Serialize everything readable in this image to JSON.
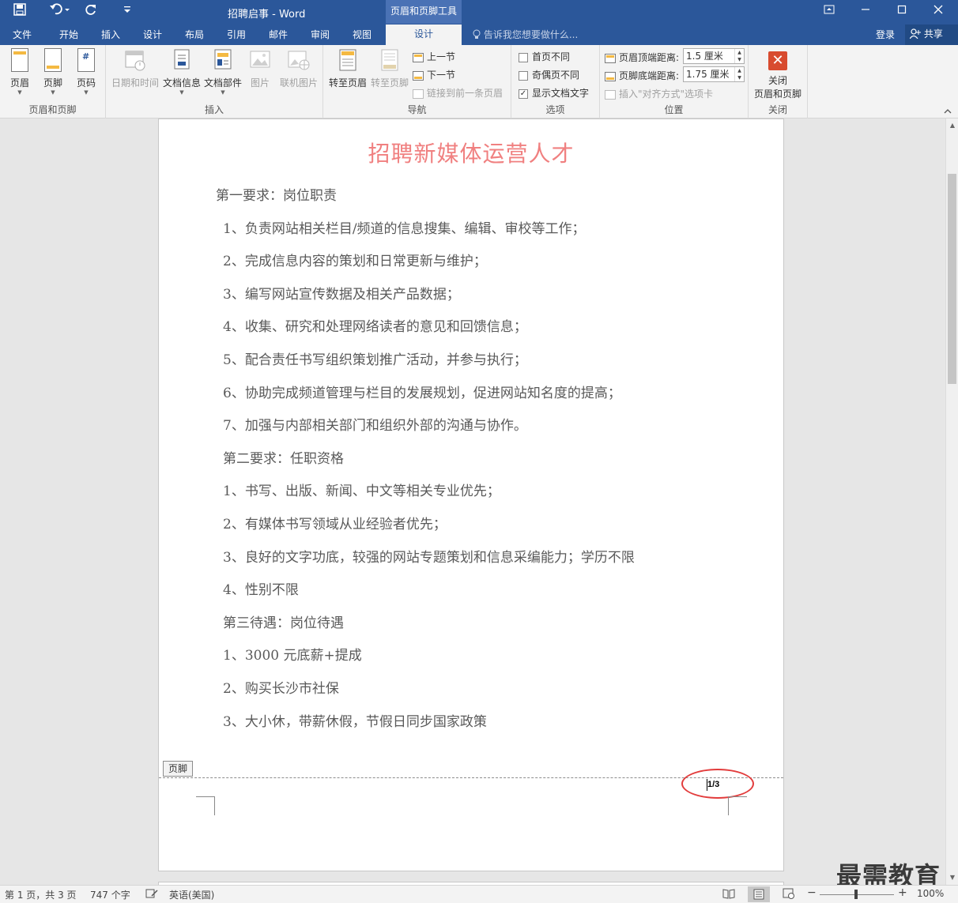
{
  "titlebar": {
    "doc_title": "招聘启事 - Word",
    "context_tool": "页眉和页脚工具",
    "save_icon": "save-icon",
    "undo_icon": "undo-icon",
    "redo_icon": "redo-icon",
    "customize_icon": "customize-qat-icon"
  },
  "tabs": [
    "文件",
    "开始",
    "插入",
    "设计",
    "布局",
    "引用",
    "邮件",
    "审阅",
    "视图",
    "设计"
  ],
  "active_tab": "设计",
  "tellme_placeholder": "告诉我您想要做什么...",
  "login": "登录",
  "share": "共享",
  "ribbon": {
    "groups": {
      "hf": "页眉和页脚",
      "insert": "插入",
      "nav": "导航",
      "options": "选项",
      "position": "位置",
      "close": "关闭"
    },
    "hf_buttons": [
      "页眉",
      "页脚",
      "页码"
    ],
    "insert_buttons": [
      "日期和时间",
      "文档信息",
      "文档部件",
      "图片",
      "联机图片"
    ],
    "nav_big": [
      "转至页眉",
      "转至页脚"
    ],
    "nav_small": [
      "上一节",
      "下一节",
      "链接到前一条页眉"
    ],
    "options": [
      {
        "label": "首页不同",
        "checked": false
      },
      {
        "label": "奇偶页不同",
        "checked": false
      },
      {
        "label": "显示文档文字",
        "checked": true
      }
    ],
    "position": {
      "header_label": "页眉顶端距离:",
      "header_value": "1.5 厘米",
      "footer_label": "页脚底端距离:",
      "footer_value": "1.75 厘米",
      "align_tab": "插入\"对齐方式\"选项卡"
    },
    "close_label_1": "关闭",
    "close_label_2": "页眉和页脚"
  },
  "document": {
    "title": "招聘新媒体运营人才",
    "lines": [
      "第一要求：岗位职责",
      "1、负责网站相关栏目/频道的信息搜集、编辑、审校等工作；",
      "2、完成信息内容的策划和日常更新与维护；",
      "3、编写网站宣传数据及相关产品数据；",
      "4、收集、研究和处理网络读者的意见和回馈信息；",
      "5、配合责任书写组织策划推广活动，并参与执行；",
      "6、协助完成频道管理与栏目的发展规划，促进网站知名度的提高；",
      "7、加强与内部相关部门和组织外部的沟通与协作。",
      "第二要求：任职资格",
      "1、书写、出版、新闻、中文等相关专业优先；",
      "2、有媒体书写领域从业经验者优先；",
      "3、良好的文字功底，较强的网站专题策划和信息采编能力；学历不限",
      "4、性别不限",
      "第三待遇：岗位待遇",
      "1、3000 元底薪+提成",
      "2、购买长沙市社保",
      "3、大小休，带薪休假，节假日同步国家政策"
    ],
    "footer_tag": "页脚",
    "page_number": "1/3"
  },
  "status": {
    "page": "第 1 页，共 3 页",
    "words": "747 个字",
    "language": "英语(美国)",
    "zoom": "100%"
  },
  "watermark": "最需教育",
  "colors": {
    "brand": "#2b579a",
    "title_red": "#f08080",
    "annotation_circle": "#e23c3c"
  }
}
